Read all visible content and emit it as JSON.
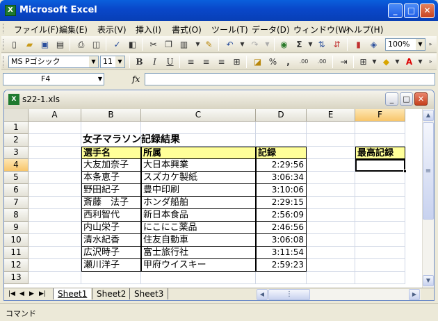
{
  "app": {
    "title": "Microsoft Excel",
    "icon_letter": "X"
  },
  "window_buttons": {
    "minimize": "_",
    "maximize": "□",
    "close": "✕"
  },
  "menu": [
    "ファイル(F)",
    "編集(E)",
    "表示(V)",
    "挿入(I)",
    "書式(O)",
    "ツール(T)",
    "データ(D)",
    "ウィンドウ(W)",
    "ヘルプ(H)"
  ],
  "toolbar": {
    "zoom": "100%",
    "font_name": "MS Pゴシック",
    "font_size": "11",
    "bold": "B",
    "italic": "I",
    "underline": "U",
    "percent": "%",
    "comma": ",",
    "inc_decimal": ".00",
    "dec_decimal": ".00",
    "autosum": "Σ",
    "font_color": "A"
  },
  "formula_bar": {
    "cell_ref": "F4",
    "fx": "fx",
    "value": ""
  },
  "workbook": {
    "filename": "s22-1.xls"
  },
  "sheet": {
    "columns": [
      "A",
      "B",
      "C",
      "D",
      "E",
      "F"
    ],
    "rows": [
      "1",
      "2",
      "3",
      "4",
      "5",
      "6",
      "7",
      "8",
      "9",
      "10",
      "11",
      "12",
      "13"
    ],
    "title": "女子マラソン記録結果",
    "headers": {
      "name": "選手名",
      "team": "所属",
      "record": "記録",
      "best": "最高記録"
    },
    "records": [
      {
        "name": "大友加奈子",
        "team": "大日本興業",
        "time": "2:29:56"
      },
      {
        "name": "本条恵子",
        "team": "スズカケ製紙",
        "time": "3:06:34"
      },
      {
        "name": "野田紀子",
        "team": "豊中印刷",
        "time": "3:10:06"
      },
      {
        "name": "斎藤　法子",
        "team": "ホンダ船舶",
        "time": "2:29:15"
      },
      {
        "name": "西利智代",
        "team": "新日本食品",
        "time": "2:56:09"
      },
      {
        "name": "内山栄子",
        "team": "にこにこ薬品",
        "time": "2:46:56"
      },
      {
        "name": "清水紀香",
        "team": "住友自動車",
        "time": "3:06:08"
      },
      {
        "name": "広沢時子",
        "team": "富士旅行社",
        "time": "3:11:54"
      },
      {
        "name": "瀬川洋子",
        "team": "甲府ウイスキー",
        "time": "2:59:23"
      }
    ],
    "active_cell": "F4"
  },
  "tabs": [
    "Sheet1",
    "Sheet2",
    "Sheet3"
  ],
  "status": "コマンド",
  "colors": {
    "header_fill": "#ffff99",
    "active_header": "#f8c66b",
    "title_bar": "#0947c9"
  }
}
